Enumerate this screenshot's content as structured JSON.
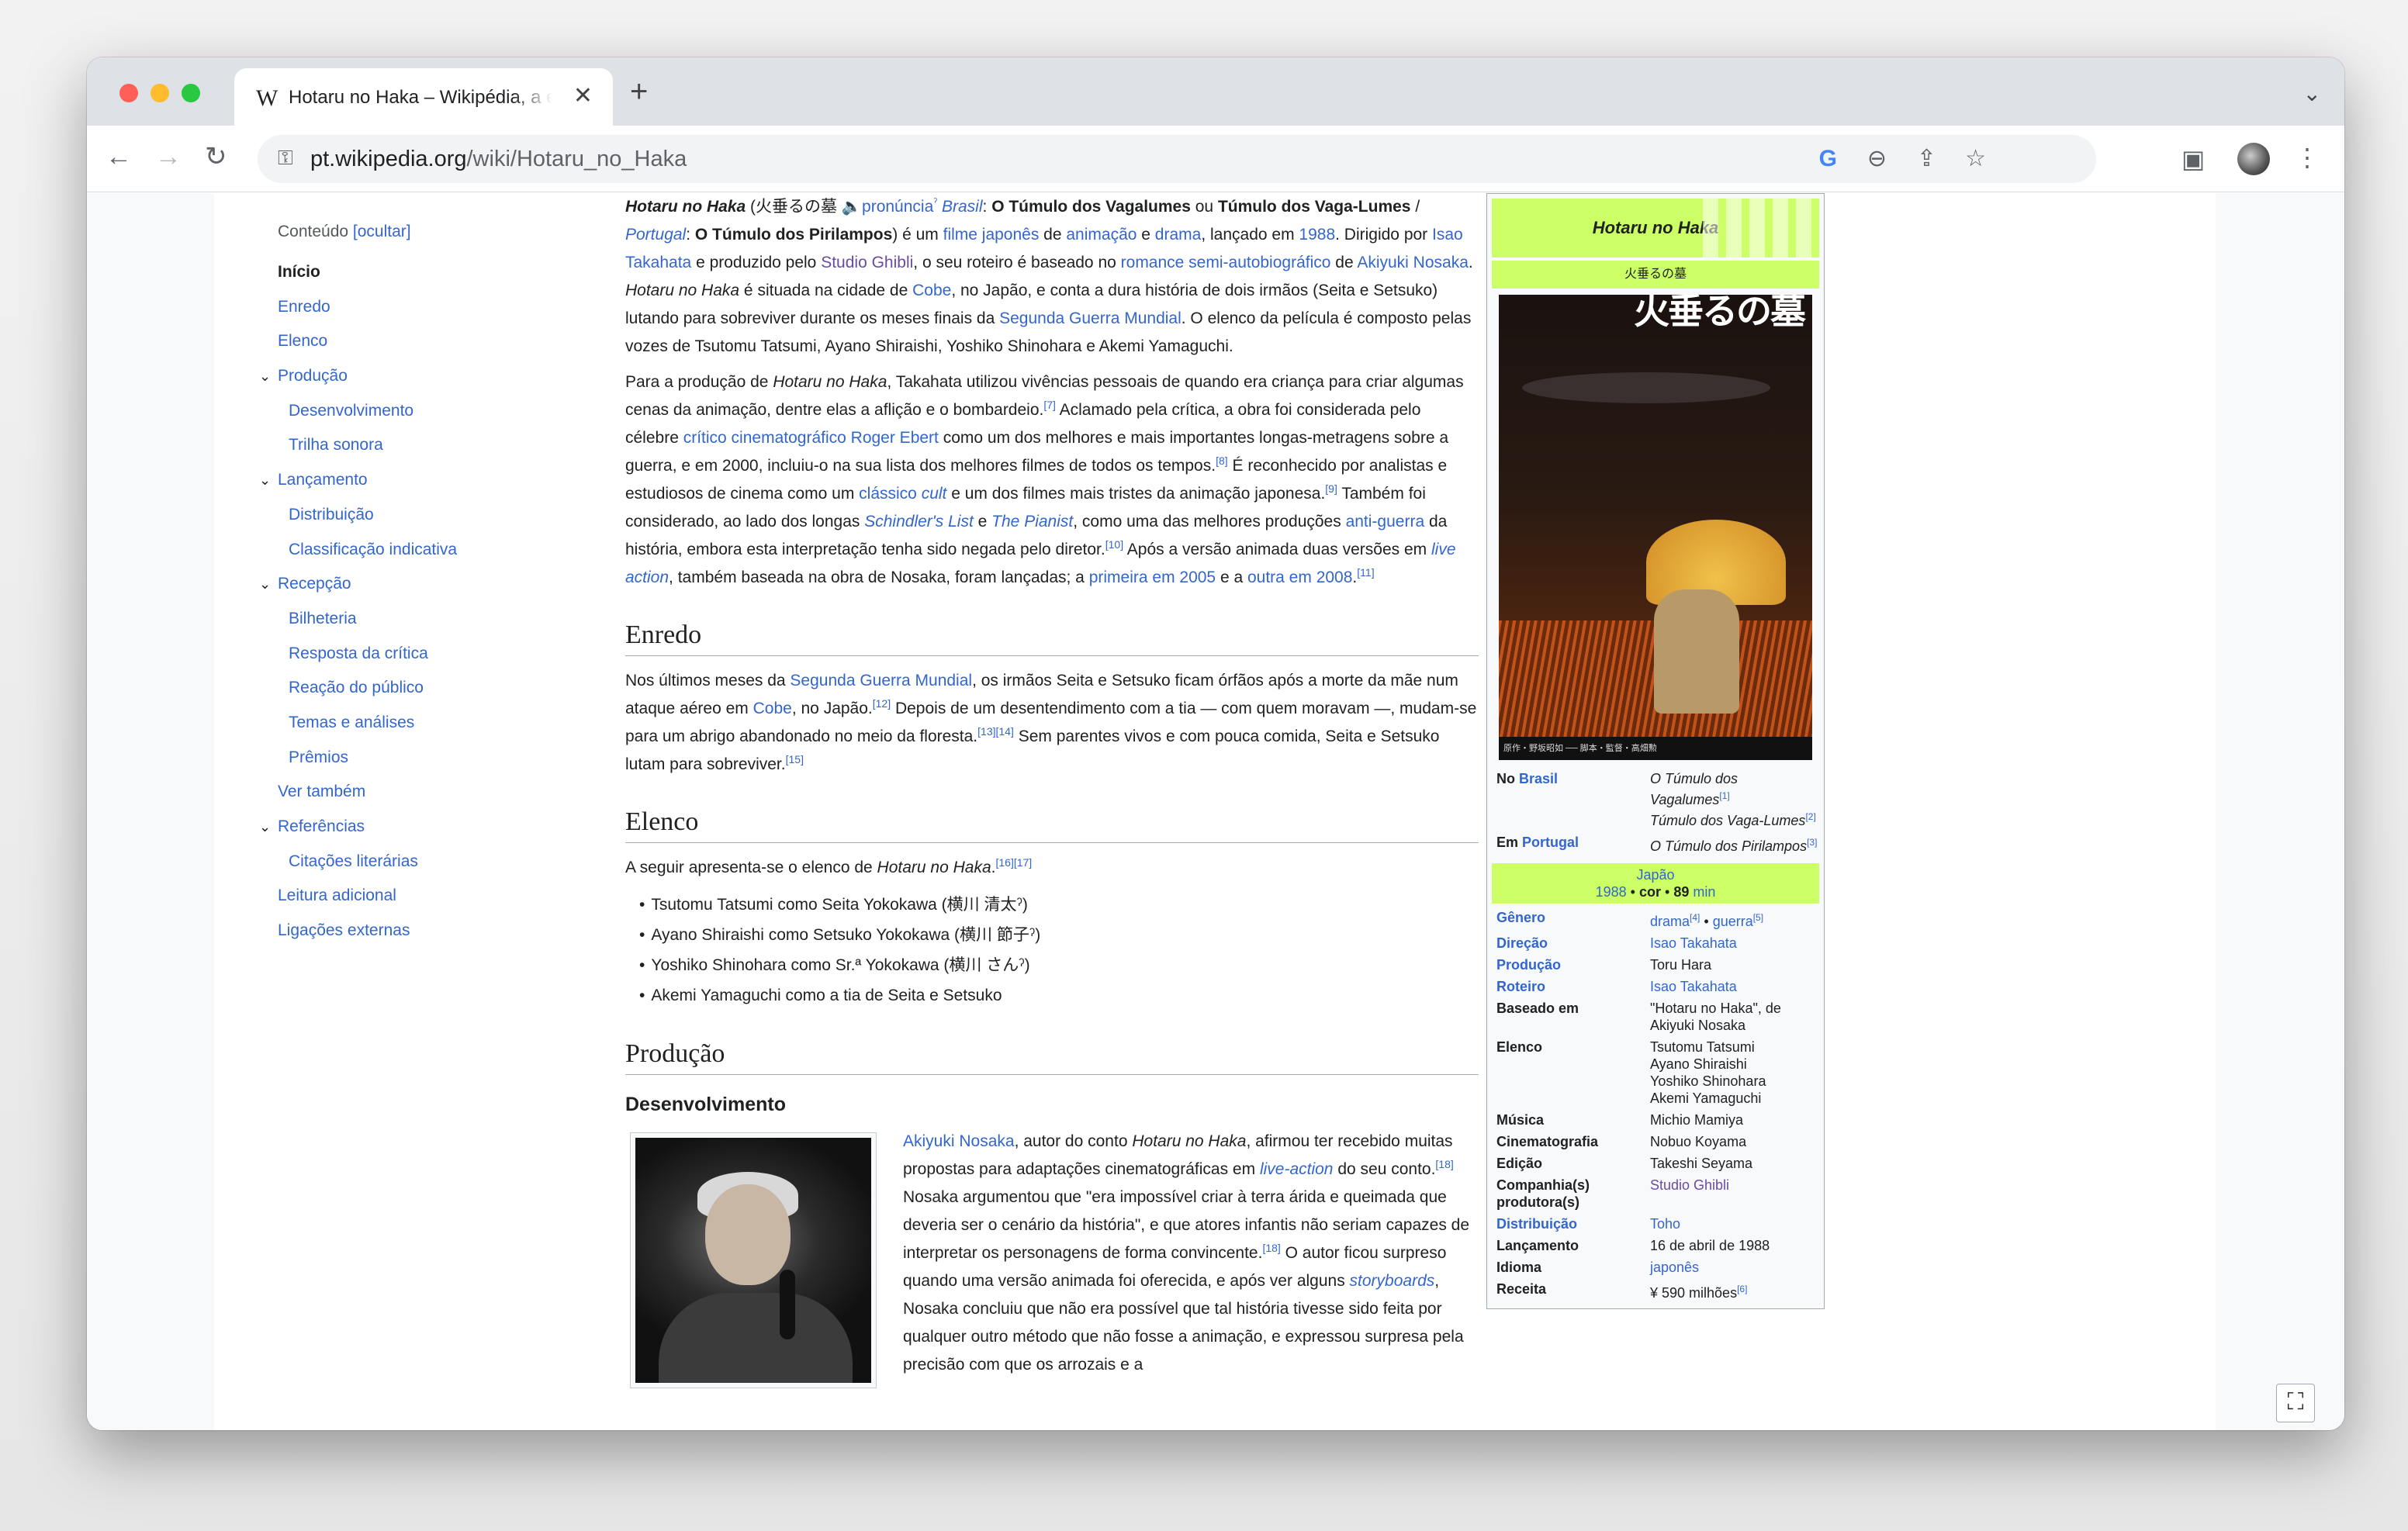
{
  "browser": {
    "tab": {
      "favicon": "W",
      "title": "Hotaru no Haka – Wikipédia, a enciclopédia livre",
      "close": "✕"
    },
    "new_tab": "+",
    "tab_menu": "⌄",
    "nav": {
      "back": "←",
      "forward": "→",
      "reload": "↻"
    },
    "url_host": "pt.wikipedia.org",
    "url_path": "/wiki/Hotaru_no_Haka",
    "icons": {
      "google": "G",
      "zoom": "⊖",
      "share": "⇪",
      "bookmark": "☆",
      "side_panel": "▣",
      "menu": "⋮",
      "lock": "🔒"
    }
  },
  "toc": {
    "heading": "Conteúdo",
    "hide_label": "[ocultar]",
    "items": [
      {
        "label": "Início",
        "level": 1,
        "active": true
      },
      {
        "label": "Enredo",
        "level": 1
      },
      {
        "label": "Elenco",
        "level": 1
      },
      {
        "label": "Produção",
        "level": 1,
        "expandable": true
      },
      {
        "label": "Desenvolvimento",
        "level": 2
      },
      {
        "label": "Trilha sonora",
        "level": 2
      },
      {
        "label": "Lançamento",
        "level": 1,
        "expandable": true
      },
      {
        "label": "Distribuição",
        "level": 2
      },
      {
        "label": "Classificação indicativa",
        "level": 2
      },
      {
        "label": "Recepção",
        "level": 1,
        "expandable": true
      },
      {
        "label": "Bilheteria",
        "level": 2
      },
      {
        "label": "Resposta da crítica",
        "level": 2
      },
      {
        "label": "Reação do público",
        "level": 2
      },
      {
        "label": "Temas e análises",
        "level": 2
      },
      {
        "label": "Prêmios",
        "level": 2
      },
      {
        "label": "Ver também",
        "level": 1
      },
      {
        "label": "Referências",
        "level": 1,
        "expandable": true
      },
      {
        "label": "Citações literárias",
        "level": 2
      },
      {
        "label": "Leitura adicional",
        "level": 1
      },
      {
        "label": "Ligações externas",
        "level": 1
      }
    ]
  },
  "article": {
    "intro_p1": {
      "title": "Hotaru no Haka",
      "jp": " (火垂るの墓 ",
      "pronuncia": "pronúncia",
      "brasil": "Brasil",
      "br_title": "O Túmulo dos Vagalumes",
      "ou": " ou ",
      "br_title2": "Túmulo dos Vaga-Lumes",
      "slash": " / ",
      "portugal": "Portugal",
      "pt_title": "O Túmulo dos Pirilampos",
      "e_um": ") é um ",
      "filme_japones": "filme japonês",
      "de": " de ",
      "animacao": "animação",
      "e": " e ",
      "drama": "drama",
      "lancado": ", lançado em ",
      "year": "1988",
      "dirigido": ". Dirigido por ",
      "director": "Isao Takahata",
      "produzido": " e produzido pelo ",
      "studio": "Studio Ghibli",
      "roteiro": ", o seu roteiro é baseado no ",
      "romance": "romance semi-autobiográfico",
      "de2": " de ",
      "author": "Akiyuki Nosaka",
      "dot": ". ",
      "title2": "Hotaru no Haka",
      "situada": " é situada na cidade de ",
      "cobe": "Cobe",
      "japao": ", no Japão, e conta a dura história de dois irmãos (Seita e Setsuko) lutando para sobreviver durante os meses finais da ",
      "war": "Segunda Guerra Mundial",
      "elenco": ". O elenco da película é composto pelas vozes de Tsutomu Tatsumi, Ayano Shiraishi, Yoshiko Shinohara e Akemi Yamaguchi."
    },
    "intro_p2": {
      "a": "Para a produção de ",
      "title": "Hotaru no Haka",
      "b": ", Takahata utilizou vivências pessoais de quando era criança para criar algumas cenas da animação, dentre elas a aflição e o bombardeio.",
      "r7": "[7]",
      "c": " Aclamado pela crítica, a obra foi considerada pelo célebre ",
      "critico": "crítico cinematográfico",
      "sp": " ",
      "ebert": "Roger Ebert",
      "d": " como um dos melhores e mais importantes longas-metragens sobre a guerra, e em 2000, incluiu-o na sua lista dos melhores filmes de todos os tempos.",
      "r8": "[8]",
      "e": " É reconhecido por analistas e estudiosos de cinema como um ",
      "classico": "clássico",
      "sp2": " ",
      "cult": "cult",
      "f": " e um dos filmes mais tristes da animação japonesa.",
      "r9": "[9]",
      "g": " Também foi considerado, ao lado dos longas ",
      "schindler": "Schindler's List",
      "e2": " e ",
      "pianist": "The Pianist",
      "h": ", como uma das melhores produções ",
      "antiguerra": "anti-guerra",
      "i": " da história, embora esta interpretação tenha sido negada pelo diretor.",
      "r10": "[10]",
      "j": " Após a versão animada duas versões em ",
      "live": "live action",
      "k": ", também baseada na obra de Nosaka, foram lançadas; a ",
      "primeira": "primeira em 2005",
      "l": " e a ",
      "outra": "outra em 2008",
      "m": ".",
      "r11": "[11]"
    },
    "h_enredo": "Enredo",
    "enredo": {
      "a": "Nos últimos meses da ",
      "war": "Segunda Guerra Mundial",
      "b": ", os irmãos Seita e Setsuko ficam órfãos após a morte da mãe num ataque aéreo em ",
      "cobe": "Cobe",
      "c": ", no Japão.",
      "r12": "[12]",
      "d": " Depois de um desentendimento com a tia — com quem moravam —, mudam-se para um abrigo abandonado no meio da floresta.",
      "r13": "[13][14]",
      "e": " Sem parentes vivos e com pouca comida, Seita e Setsuko lutam para sobreviver.",
      "r15": "[15]"
    },
    "h_elenco": "Elenco",
    "elenco_intro": {
      "a": "A seguir apresenta-se o elenco de ",
      "title": "Hotaru no Haka",
      "b": ".",
      "refs": "[16][17]"
    },
    "cast": [
      "Tsutomu Tatsumi como Seita Yokokawa (横川 清太ˀ)",
      "Ayano Shiraishi como Setsuko Yokokawa (横川 節子ˀ)",
      "Yoshiko Shinohara como Sr.ª Yokokawa (横川 さんˀ)",
      "Akemi Yamaguchi como a tia de Seita e Setsuko"
    ],
    "h_producao": "Produção",
    "h_desenv": "Desenvolvimento",
    "desenv": {
      "author": "Akiyuki Nosaka",
      "a": ", autor do conto ",
      "title": "Hotaru no Haka",
      "b": ", afirmou ter recebido muitas propostas para adaptações cinematográficas em ",
      "live": "live-action",
      "c": " do seu conto.",
      "r18": "[18]",
      "d": " Nosaka argumentou que \"era impossível criar à terra árida e queimada que deveria ser o cenário da história\", e que atores infantis não seriam capazes de interpretar os personagens de forma convincente.",
      "r18b": "[18]",
      "e": " O autor ficou surpreso quando uma versão animada foi oferecida, e após ver alguns ",
      "storyboards": "storyboards",
      "f": ", Nosaka concluiu que não era possível que tal história tivesse sido feita por qualquer outro método que não fosse a animação, e expressou surpresa pela precisão com que os arrozais e a"
    }
  },
  "infobox": {
    "title": "Hotaru no Haka",
    "subtitle": "火垂るの墓",
    "poster_kanji": "火垂るの墓",
    "poster_credits": "原作・野坂昭如 ── 脚本・監督・高畑勲",
    "rows_top": [
      {
        "label_pre": "No ",
        "label_link": "Brasil",
        "value": "O Túmulo dos Vagalumes",
        "sup": "[1]",
        "value2": "Túmulo dos Vaga-Lumes",
        "sup2": "[2]"
      },
      {
        "label_pre": "Em ",
        "label_link": "Portugal",
        "value": "O Túmulo dos Pirilampos",
        "sup": "[3]"
      }
    ],
    "band": {
      "country": "Japão",
      "year": "1988",
      "sep1": " • ",
      "color": "cor",
      "sep2": " •  ",
      "duration": "89",
      "min": "min"
    },
    "rows": [
      {
        "label": "Gênero",
        "label_is_link": true,
        "value": "drama",
        "sup": "[4]",
        "extra": " • ",
        "value2": "guerra",
        "sup2": "[5]",
        "link": true
      },
      {
        "label": "Direção",
        "label_is_link": true,
        "value": "Isao Takahata",
        "link": true
      },
      {
        "label": "Produção",
        "label_is_link": true,
        "value": "Toru Hara"
      },
      {
        "label": "Roteiro",
        "label_is_link": true,
        "value": "Isao Takahata",
        "link": true
      },
      {
        "label": "Baseado em",
        "value": "\"Hotaru no Haka\", de Akiyuki Nosaka"
      },
      {
        "label": "Elenco",
        "value": "Tsutomu Tatsumi\nAyano Shiraishi\nYoshiko Shinohara\nAkemi Yamaguchi"
      },
      {
        "label": "Música",
        "value": "Michio Mamiya"
      },
      {
        "label": "Cinematografia",
        "value": "Nobuo Koyama"
      },
      {
        "label": "Edição",
        "value": "Takeshi Seyama"
      },
      {
        "label": "Companhia(s) produtora(s)",
        "value": "Studio Ghibli",
        "visited": true
      },
      {
        "label": "Distribuição",
        "label_is_link": true,
        "value": "Toho",
        "link": true
      },
      {
        "label": "Lançamento",
        "value": "16 de abril de 1988"
      },
      {
        "label": "Idioma",
        "value": "japonês",
        "link": true
      },
      {
        "label": "Receita",
        "value": "¥ 590 milhões",
        "sup": "[6]"
      }
    ]
  },
  "expand_icon": "⛶"
}
